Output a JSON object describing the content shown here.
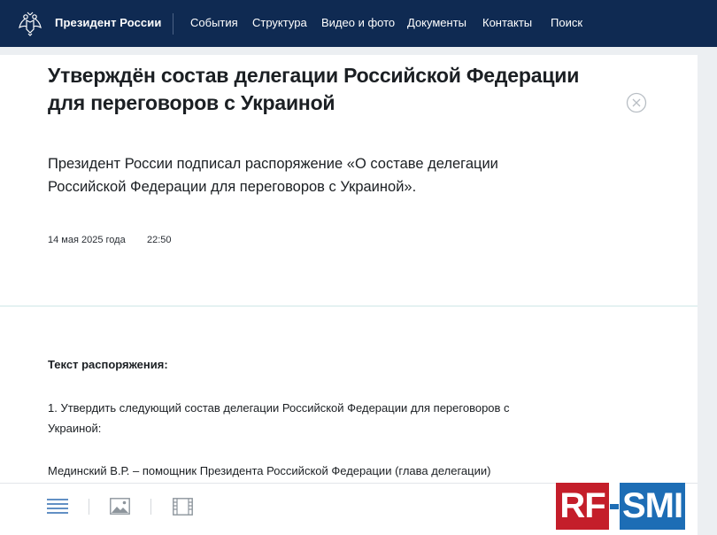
{
  "header": {
    "brand": "Президент России",
    "nav": [
      "События",
      "Структура",
      "Видео и фото",
      "Документы",
      "Контакты",
      "Поиск"
    ]
  },
  "article": {
    "title": "Утверждён состав делегации Российской Федерации для переговоров с Украиной",
    "lead": "Президент России подписал распоряжение «О составе делегации Российской Федерации для переговоров с Украиной».",
    "date": "14 мая 2025 года",
    "time": "22:50",
    "subhead": "Текст распоряжения:",
    "para1": "1. Утвердить следующий состав делегации Российской Федерации для переговоров с Украиной:",
    "para2": "Мединский В.Р. – помощник Президента Российской Федерации (глава делегации)"
  },
  "watermark": {
    "left": "RF",
    "right": "SMI"
  },
  "colors": {
    "nav_bg": "#0f2a52",
    "watermark_red": "#c41e2a",
    "watermark_blue": "#1d6db5"
  },
  "icons": [
    "emblem-icon",
    "close-icon",
    "text-view-icon",
    "photo-icon",
    "video-icon"
  ]
}
